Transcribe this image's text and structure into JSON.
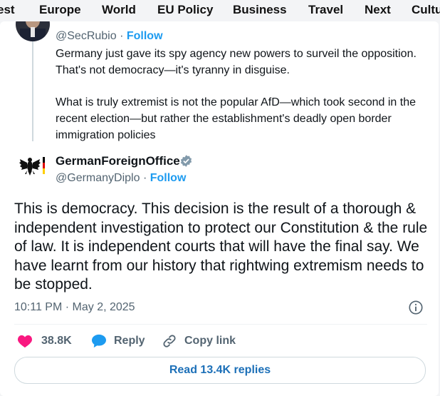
{
  "nav": {
    "items": [
      "est",
      "Europe",
      "World",
      "EU Policy",
      "Business",
      "Travel",
      "Next",
      "Cultu"
    ]
  },
  "quoted": {
    "handle": "@SecRubio",
    "separator": "·",
    "follow_label": "Follow",
    "paragraphs": [
      "Germany just gave its spy agency new powers to surveil the opposition.  That's not democracy—it's tyranny in disguise.",
      "What is truly extremist is not the popular AfD—which took second in the recent election—but rather the establishment's deadly open border immigration policies"
    ]
  },
  "post": {
    "author_name": "GermanForeignOffice",
    "handle": "@GermanyDiplo",
    "separator": "·",
    "follow_label": "Follow",
    "text": "This is democracy. This decision is the result of a thorough & independent investigation to protect our Constitution & the rule of law. It is independent courts that will have the final say. We have learnt from our history that rightwing extremism needs to be stopped.",
    "timestamp": "10:11 PM · May 2, 2025"
  },
  "actions": {
    "like_count": "38.8K",
    "reply_label": "Reply",
    "copy_link_label": "Copy link"
  },
  "footer": {
    "read_replies_label": "Read 13.4K replies"
  },
  "colors": {
    "link": "#1d9bf0",
    "like": "#f91880",
    "reply": "#1d9bf0",
    "verified": "#829aab"
  }
}
